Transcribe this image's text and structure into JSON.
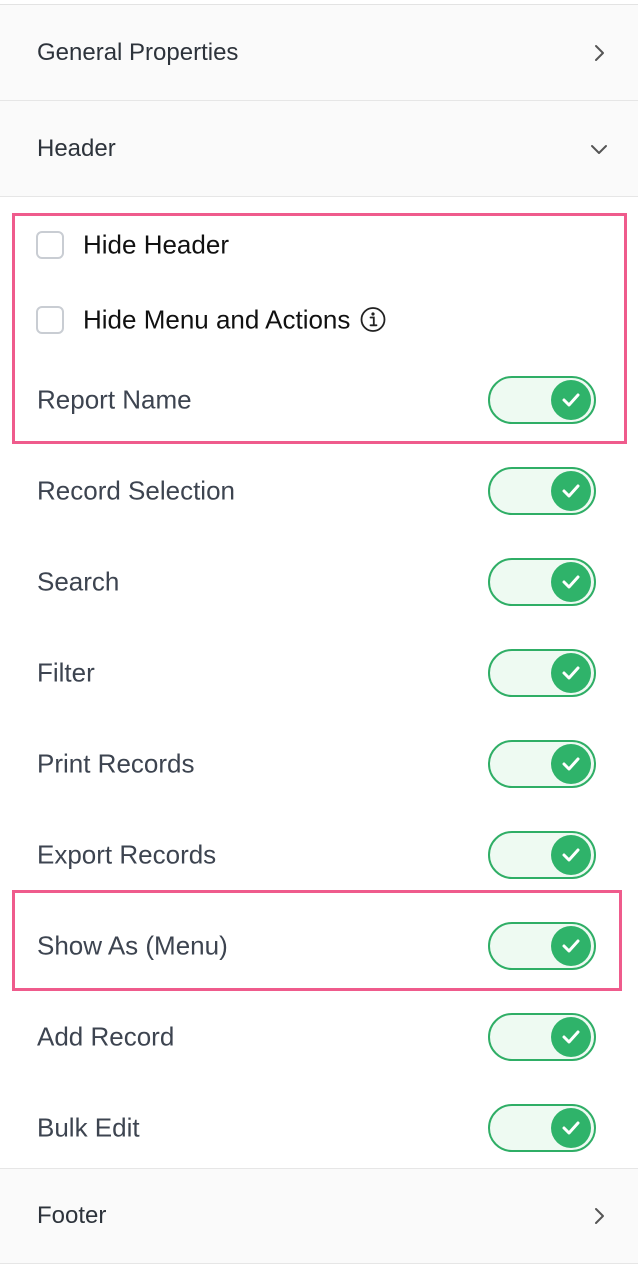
{
  "sections": {
    "general": {
      "label": "General Properties",
      "expanded": false
    },
    "header": {
      "label": "Header",
      "expanded": true
    },
    "footer": {
      "label": "Footer",
      "expanded": false
    }
  },
  "header_options": {
    "hide_header": {
      "label": "Hide Header",
      "checked": false
    },
    "hide_menu": {
      "label": "Hide Menu and Actions",
      "checked": false,
      "icon": "info-icon"
    }
  },
  "toggles": [
    {
      "label": "Report Name",
      "on": true
    },
    {
      "label": "Record Selection",
      "on": true
    },
    {
      "label": "Search",
      "on": true
    },
    {
      "label": "Filter",
      "on": true
    },
    {
      "label": "Print Records",
      "on": true
    },
    {
      "label": "Export Records",
      "on": true
    },
    {
      "label": "Show As (Menu)",
      "on": true
    },
    {
      "label": "Add Record",
      "on": true
    },
    {
      "label": "Bulk Edit",
      "on": true
    }
  ],
  "colors": {
    "toggle_on": "#2fb36a",
    "highlight": "#ef5b8c"
  }
}
